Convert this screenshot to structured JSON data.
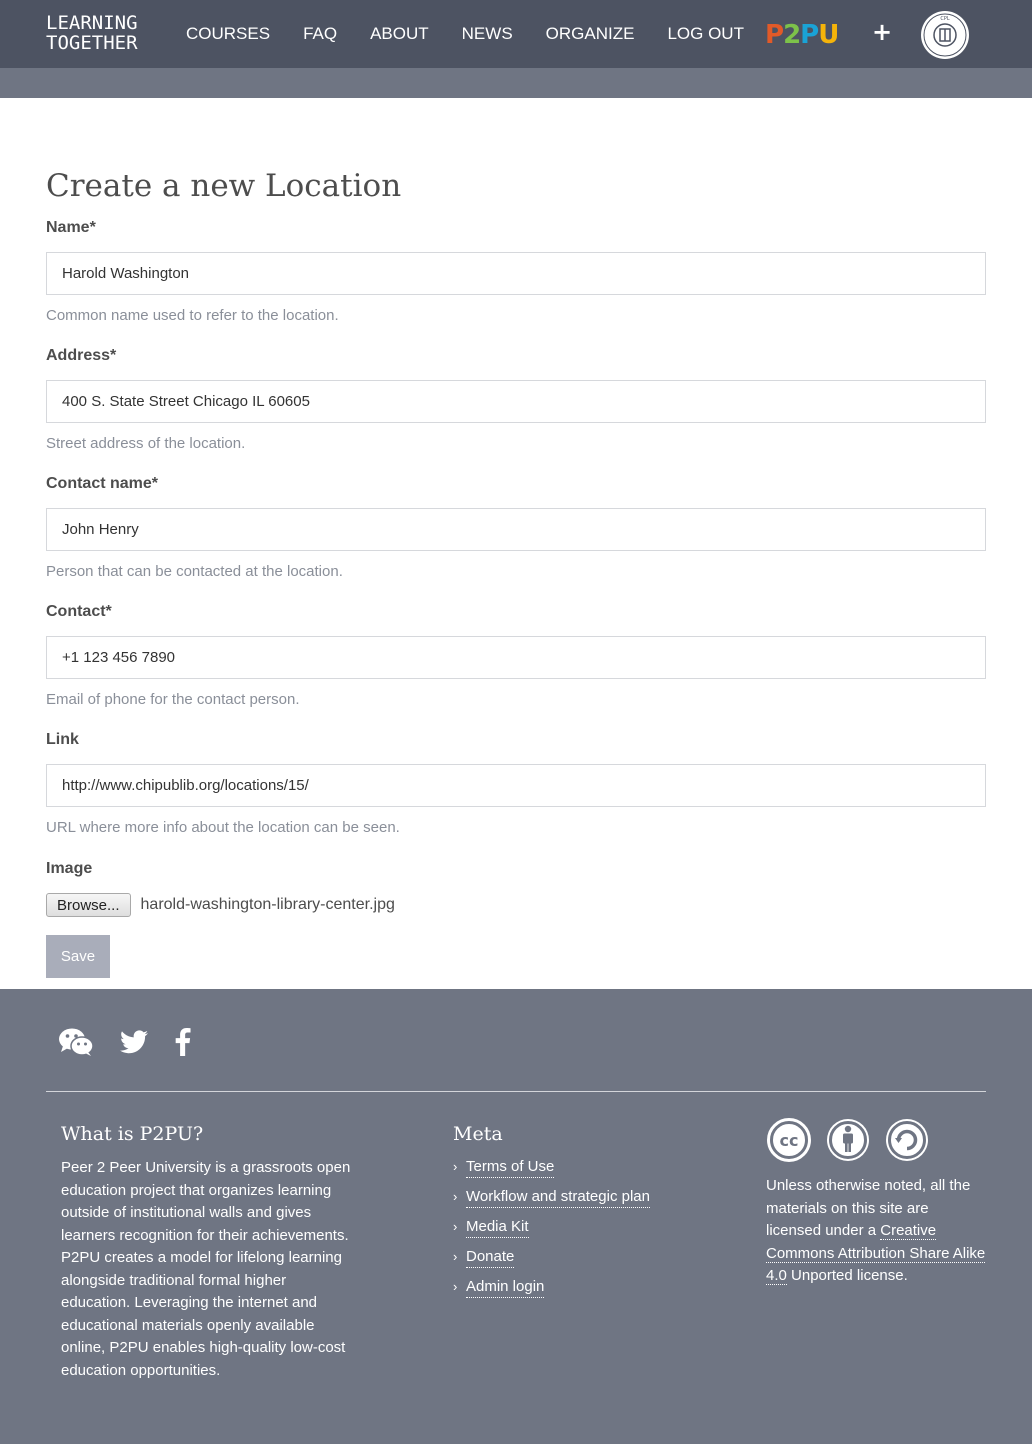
{
  "header": {
    "brand_line1": "LEARNING",
    "brand_line2": "TOGETHER",
    "nav": [
      "COURSES",
      "FAQ",
      "ABOUT",
      "NEWS",
      "ORGANIZE",
      "LOG OUT"
    ],
    "partner_logo_text": [
      "P",
      "2",
      "P",
      "U"
    ],
    "plus": "+",
    "library_logo_text": "CHICAGO PUBLIC LIBRARY"
  },
  "form": {
    "title": "Create a new Location",
    "fields": [
      {
        "label": "Name*",
        "value": "Harold Washington",
        "help": "Common name used to refer to the location."
      },
      {
        "label": "Address*",
        "value": "400 S. State Street Chicago IL 60605",
        "help": "Street address of the location."
      },
      {
        "label": "Contact name*",
        "value": "John Henry",
        "help": "Person that can be contacted at the location."
      },
      {
        "label": "Contact*",
        "value": "+1 123 456 7890",
        "help": "Email of phone for the contact person."
      },
      {
        "label": "Link",
        "value": "http://www.chipublib.org/locations/15/",
        "help": "URL where more info about the location can be seen."
      }
    ],
    "image": {
      "label": "Image",
      "browse_label": "Browse...",
      "file_name": "harold-washington-library-center.jpg"
    },
    "save_label": "Save"
  },
  "footer": {
    "social_icons": [
      "wechat-icon",
      "twitter-icon",
      "facebook-icon"
    ],
    "about": {
      "title": "What is P2PU?",
      "text": "Peer 2 Peer University is a grassroots open education project that organizes learning outside of institutional walls and gives learners recognition for their achievements. P2PU creates a model for lifelong learning alongside traditional formal higher education. Leveraging the internet and educational materials openly available online, P2PU enables high-quality low-cost education opportunities."
    },
    "meta": {
      "title": "Meta",
      "links": [
        "Terms of Use",
        "Workflow and strategic plan",
        "Media Kit",
        "Donate",
        "Admin login"
      ]
    },
    "license": {
      "text_before": "Unless otherwise noted, all the materials on this site are licensed under a ",
      "link": "Creative Commons Attribution Share Alike 4.0",
      "text_after": " Unported license."
    }
  },
  "colors": {
    "header_bg": "#4d5362",
    "subbar_bg": "#6f7583",
    "footer_bg": "#6f7583",
    "save_bg": "#a9adba"
  }
}
